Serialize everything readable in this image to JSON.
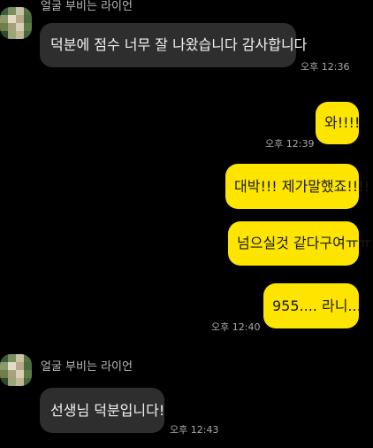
{
  "colors": {
    "background": "#000000",
    "incoming_bubble": "#2e2e2e",
    "outgoing_bubble": "#fee500",
    "outgoing_text": "#191919",
    "incoming_text": "#f2f2f2",
    "sender_name": "#b9b9b9",
    "timestamp": "#a9a9a9"
  },
  "avatar_colors": [
    "#3d5a3a",
    "#7a8f5e",
    "#c9c4a8",
    "#54703f",
    "#8a9a6a",
    "#e3dcc3",
    "#b7a98a",
    "#4b6a3d",
    "#6e7f4c",
    "#a7a07c",
    "#d8d0b6",
    "#5e7a45",
    "#2f4a2c",
    "#9aa676",
    "#c2b894",
    "#476540"
  ],
  "messages": {
    "m1": {
      "sender": "얼굴 부비는 라이언",
      "text": "덕분에 점수 너무 잘 나왔습니다 감사합니다",
      "time": "오후 12:36"
    },
    "m2": {
      "text": "와!!!!",
      "time": "오후 12:39"
    },
    "m3": {
      "text": "대박!!! 제가말했죠!!!!"
    },
    "m4": {
      "text": "넘으실것 같다구여ㅠㅠㅠ"
    },
    "m5": {
      "text": "955.... 라니...",
      "time": "오후 12:40"
    },
    "m6": {
      "sender": "얼굴 부비는 라이언",
      "text": "선생님 덕분입니다!",
      "time": "오후 12:43"
    }
  }
}
